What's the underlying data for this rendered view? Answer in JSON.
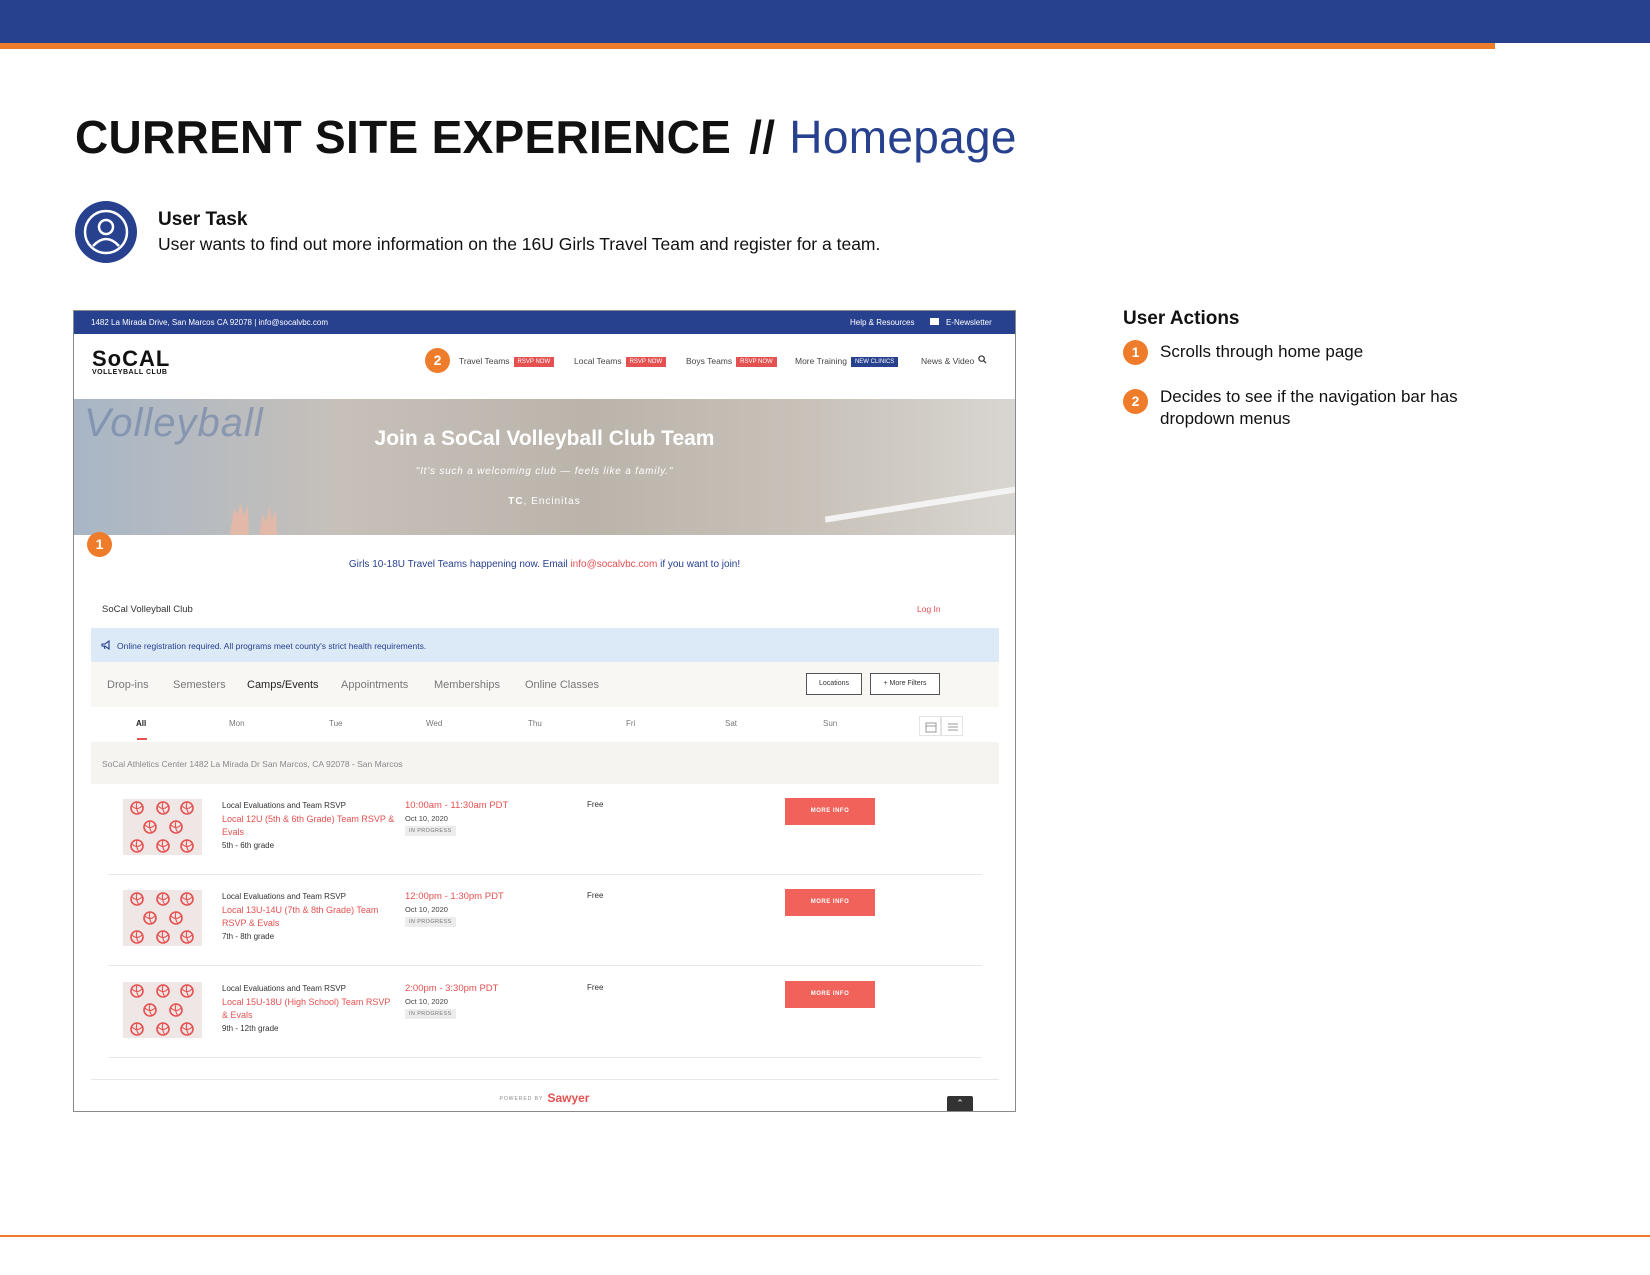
{
  "colors": {
    "brand_blue": "#27418f",
    "accent_orange": "#ef7c2a",
    "site_red": "#e55050",
    "notice_blue": "#dce9f6"
  },
  "header": {
    "title_bold": "CURRENT SITE EXPERIENCE",
    "separator": "//",
    "title_light": "Homepage"
  },
  "user_task": {
    "icon": "user-icon",
    "title": "User Task",
    "text": "User wants to find out more information on the 16U Girls Travel Team and register for a team."
  },
  "screenshot": {
    "topbar": {
      "address": "1482 La Mirada Drive, San Marcos CA 92078 | info@socalvbc.com",
      "help": "Help & Resources",
      "newsletter": "E-Newsletter"
    },
    "logo": {
      "line1": "SoCAL",
      "line2": "VOLLEYBALL CLUB"
    },
    "nav": [
      {
        "label": "Travel Teams",
        "badge": "RSVP NOW"
      },
      {
        "label": "Local Teams",
        "badge": "RSVP NOW"
      },
      {
        "label": "Boys Teams",
        "badge": "RSVP NOW"
      },
      {
        "label": "More Training",
        "badge": "NEW CLINICS"
      },
      {
        "label": "News & Video",
        "badge": ""
      }
    ],
    "hero": {
      "bg_word": "Volleyball",
      "title": "Join a SoCal Volleyball Club Team",
      "quote": "\"It's such a welcoming club — feels like a family.\"",
      "author_initials": "TC",
      "author_city": ", Encinitas"
    },
    "announcement": {
      "before": "Girls 10-18U Travel Teams happening now. Email ",
      "email": "info@socalvbc.com",
      "after": " if you want to join!"
    },
    "club_name": "SoCal Volleyball Club",
    "login": "Log In",
    "notice": "Online registration required. All programs meet county's strict health requirements.",
    "tabs": [
      "Drop-ins",
      "Semesters",
      "Camps/Events",
      "Appointments",
      "Memberships",
      "Online Classes"
    ],
    "active_tab": "Camps/Events",
    "filters": {
      "locations": "Locations",
      "more": "+ More Filters"
    },
    "days": [
      "All",
      "Mon",
      "Tue",
      "Wed",
      "Thu",
      "Fri",
      "Sat",
      "Sun"
    ],
    "location": "SoCal Athletics Center 1482 La Mirada Dr San Marcos, CA 92078 - San Marcos",
    "events": [
      {
        "category": "Local Evaluations and Team RSVP",
        "name": "Local 12U (5th & 6th Grade) Team RSVP & Evals",
        "grade": "5th - 6th grade",
        "time": "10:00am - 11:30am PDT",
        "date": "Oct 10, 2020",
        "status": "IN PROGRESS",
        "price": "Free",
        "button": "MORE INFO"
      },
      {
        "category": "Local Evaluations and Team RSVP",
        "name": "Local 13U-14U (7th & 8th Grade) Team RSVP & Evals",
        "grade": "7th - 8th grade",
        "time": "12:00pm - 1:30pm PDT",
        "date": "Oct 10, 2020",
        "status": "IN PROGRESS",
        "price": "Free",
        "button": "MORE INFO"
      },
      {
        "category": "Local Evaluations and Team RSVP",
        "name": "Local 15U-18U (High School) Team RSVP & Evals",
        "grade": "9th - 12th grade",
        "time": "2:00pm - 3:30pm PDT",
        "date": "Oct 10, 2020",
        "status": "IN PROGRESS",
        "price": "Free",
        "button": "MORE INFO"
      }
    ],
    "powered_by": "POWERED BY",
    "powered_brand": "Sawyer",
    "markers": [
      "1",
      "2"
    ]
  },
  "user_actions": {
    "title": "User Actions",
    "items": [
      {
        "num": "1",
        "text": "Scrolls through home page"
      },
      {
        "num": "2",
        "text": "Decides to see if the navigation bar has dropdown menus"
      }
    ]
  }
}
